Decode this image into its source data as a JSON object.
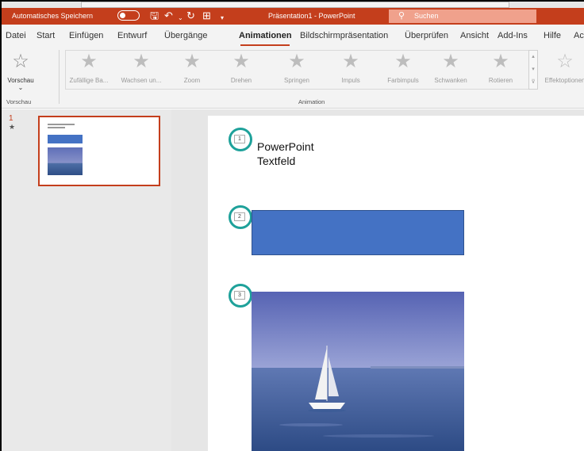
{
  "titlebar": {
    "autosave_label": "Automatisches Speichern",
    "doc_title": "Präsentation1  -  PowerPoint",
    "search_placeholder": "Suchen",
    "colors": {
      "titlebar_bg": "#c43e1c",
      "accent": "#c43e1c"
    }
  },
  "tabs": [
    {
      "label": "Datei"
    },
    {
      "label": "Start"
    },
    {
      "label": "Einfügen"
    },
    {
      "label": "Entwurf"
    },
    {
      "label": "Übergänge"
    },
    {
      "label": "Animationen",
      "active": true
    },
    {
      "label": "Bildschirmpräsentation"
    },
    {
      "label": "Überprüfen"
    },
    {
      "label": "Ansicht"
    },
    {
      "label": "Add-Ins"
    },
    {
      "label": "Hilfe"
    },
    {
      "label": "Ac"
    }
  ],
  "ribbon": {
    "preview_label": "Vorschau",
    "effects": [
      {
        "label": "Zufällige Ba...",
        "icon": "star-icon"
      },
      {
        "label": "Wachsen un...",
        "icon": "star-icon"
      },
      {
        "label": "Zoom",
        "icon": "star-icon"
      },
      {
        "label": "Drehen",
        "icon": "star-icon"
      },
      {
        "label": "Springen",
        "icon": "star-icon"
      },
      {
        "label": "Impuls",
        "icon": "star-icon"
      },
      {
        "label": "Farbimpuls",
        "icon": "star-icon"
      },
      {
        "label": "Schwanken",
        "icon": "star-icon"
      },
      {
        "label": "Rotieren",
        "icon": "star-icon"
      }
    ],
    "effect_options_label": "Effektoptionen",
    "groups": {
      "preview": "Vorschau",
      "animation": "Animation"
    }
  },
  "slides_pane": {
    "slide_number": "1",
    "slide_star": "★"
  },
  "slide": {
    "textbox_line1": "PowerPoint",
    "textbox_line2": "Textfeld",
    "anim_tags": [
      "1",
      "2",
      "3"
    ],
    "shape_color": "#4472c4",
    "ring_color": "#1ea19a"
  }
}
